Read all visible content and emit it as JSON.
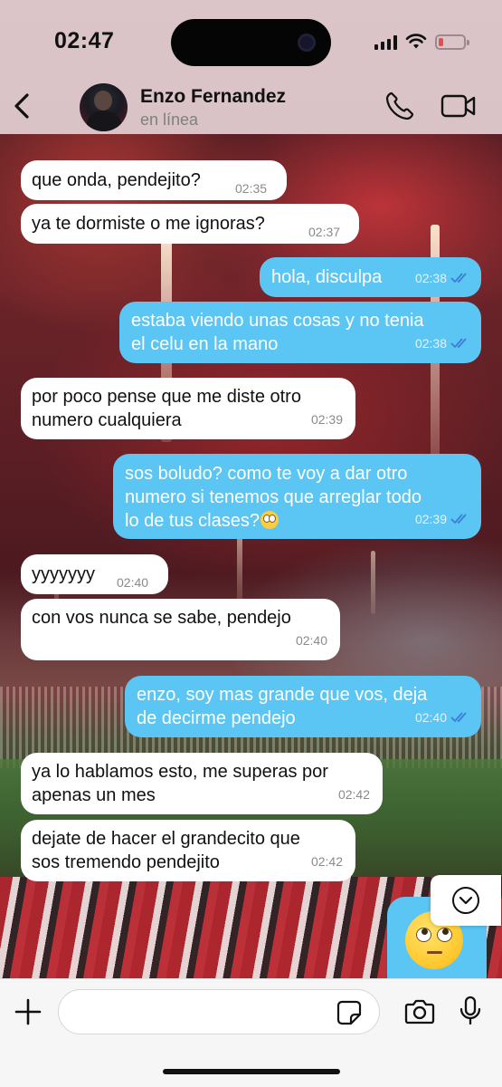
{
  "status_bar": {
    "time": "02:47"
  },
  "header": {
    "contact_name": "Enzo Fernandez",
    "contact_status": "en línea"
  },
  "messages": [
    {
      "dir": "in",
      "text": "que onda, pendejito?",
      "time": "02:35"
    },
    {
      "dir": "in",
      "text": "ya te dormiste o me ignoras?",
      "time": "02:37"
    },
    {
      "dir": "out",
      "text": "hola, disculpa",
      "time": "02:38",
      "status": "read"
    },
    {
      "dir": "out",
      "text": "estaba viendo unas cosas y no tenia\nel celu en la mano",
      "time": "02:38",
      "status": "read"
    },
    {
      "dir": "in",
      "text": "por poco pense que me diste otro\nnumero cualquiera",
      "time": "02:39"
    },
    {
      "dir": "out",
      "text": "sos boludo? como te voy a dar otro\nnumero si tenemos que arreglar todo\nlo de tus clases?",
      "emoji": "🙄",
      "time": "02:39",
      "status": "read"
    },
    {
      "dir": "in",
      "text": "yyyyyyy",
      "time": "02:40"
    },
    {
      "dir": "in",
      "text": "con vos nunca se sabe, pendejo",
      "time": "02:40"
    },
    {
      "dir": "out",
      "text": "enzo, soy mas grande que vos, deja\nde decirme pendejo",
      "time": "02:40",
      "status": "read"
    },
    {
      "dir": "in",
      "text": "ya lo hablamos esto, me superas por\napenas un mes",
      "time": "02:42"
    },
    {
      "dir": "in",
      "text": "dejate de hacer el grandecito que\nsos tremendo pendejito",
      "time": "02:42"
    },
    {
      "dir": "out",
      "emoji": "🙄",
      "status": "read"
    }
  ],
  "input": {
    "value": "",
    "placeholder": ""
  },
  "colors": {
    "outgoing_bubble": "#5bc5f3",
    "incoming_bubble": "#ffffff",
    "header_bg": "#dbc5c9",
    "read_ticks": "#3b7fd6"
  },
  "icons": {
    "back": "chevron-left-icon",
    "call": "phone-icon",
    "video": "video-camera-icon",
    "scroll_down": "chevron-down-icon",
    "attach": "plus-icon",
    "sticker": "sticker-icon",
    "camera": "camera-icon",
    "mic": "microphone-icon"
  }
}
